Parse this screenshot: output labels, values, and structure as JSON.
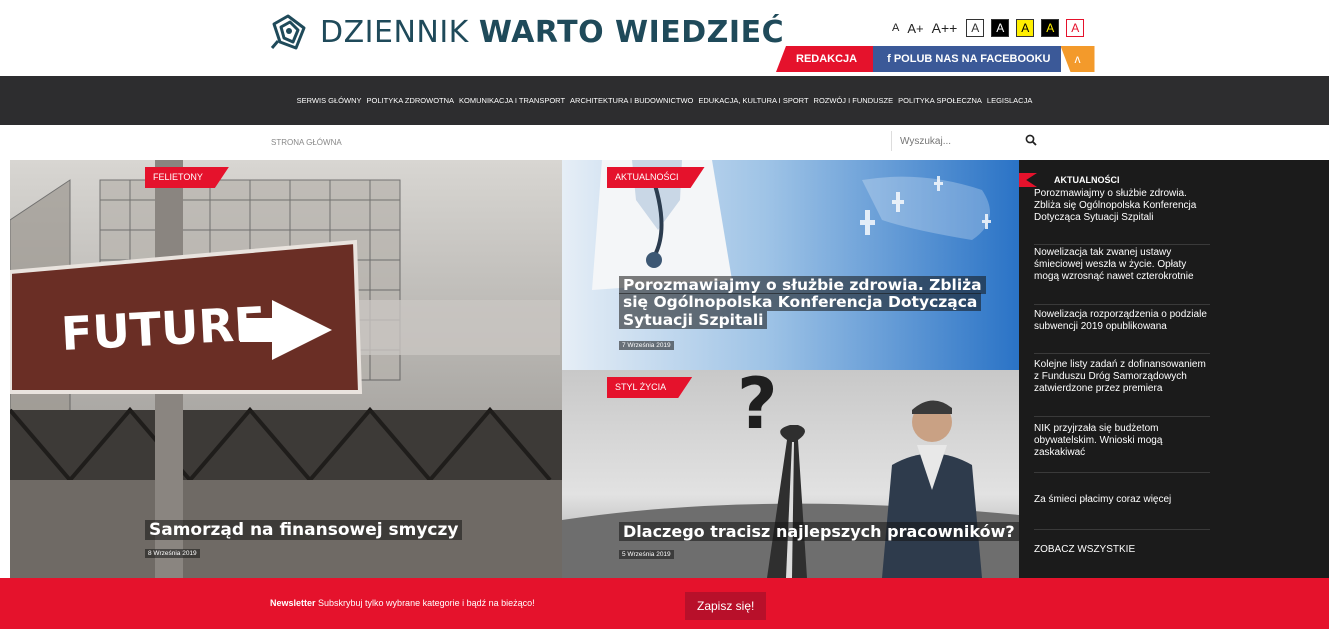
{
  "site": {
    "name_light": "DZIENNIK ",
    "name_bold": "WARTO WIEDZIEĆ"
  },
  "accessibility": {
    "font_sizes": [
      "A",
      "A+",
      "A++"
    ],
    "contrast_letters": [
      "A",
      "A",
      "A",
      "A",
      "A"
    ]
  },
  "top_buttons": {
    "redakcja": "REDAKCJA",
    "facebook": "f POLUB NAS NA FACEBOOKU",
    "rss_icon": "rss-icon"
  },
  "nav": [
    "SERWIS GŁÓWNY",
    "POLITYKA ZDROWOTNA",
    "KOMUNIKACJA I TRANSPORT",
    "ARCHITEKTURA I BUDOWNICTWO",
    "EDUKACJA, KULTURA I SPORT",
    "ROZWÓJ I FUNDUSZE",
    "POLITYKA SPOŁECZNA",
    "LEGISLACJA"
  ],
  "breadcrumb": "STRONA GŁÓWNA",
  "search": {
    "placeholder": "Wyszukaj..."
  },
  "tiles": {
    "left": {
      "tag": "FELIETONY",
      "title": "Samorząd na finansowej smyczy",
      "date": "8 Września 2019"
    },
    "top_right": {
      "tag": "AKTUALNOŚCI",
      "title": "Porozmawiajmy o służbie zdrowia. Zbliża się Ogólnopolska Konferencja Dotycząca Sytuacji Szpitali",
      "date": "7 Września 2019"
    },
    "bottom_right": {
      "tag": "STYL ŻYCIA",
      "title": "Dlaczego tracisz najlepszych pracowników?",
      "date": "5 Września 2019"
    }
  },
  "sidebar": {
    "heading": "AKTUALNOŚCI",
    "items": [
      "Porozmawiajmy o służbie zdrowia. Zbliża się Ogólnopolska Konferencja Dotycząca Sytuacji Szpitali",
      "Nowelizacja tak zwanej ustawy śmieciowej weszła w życie. Opłaty mogą wzrosnąć nawet czterokrotnie",
      "Nowelizacja rozporządzenia o podziale subwencji 2019 opublikowana",
      "Kolejne listy zadań z dofinansowaniem z Funduszu Dróg Samorządowych zatwierdzone przez premiera",
      "NIK przyjrzała się budżetom obywatelskim. Wnioski mogą zaskakiwać",
      "Za śmieci płacimy coraz więcej"
    ],
    "see_all": "ZOBACZ WSZYSTKIE"
  },
  "newsletter": {
    "label": "Newsletter",
    "text": " Subskrybuj tylko wybrane kategorie i bądź na bieżąco!",
    "button": "Zapisz się!"
  },
  "colors": {
    "accent": "#e5122c",
    "nav_bg": "#2d2d2f",
    "sidebar_bg": "#1b1b1b",
    "facebook": "#3b5998",
    "rss": "#f39a2b"
  }
}
